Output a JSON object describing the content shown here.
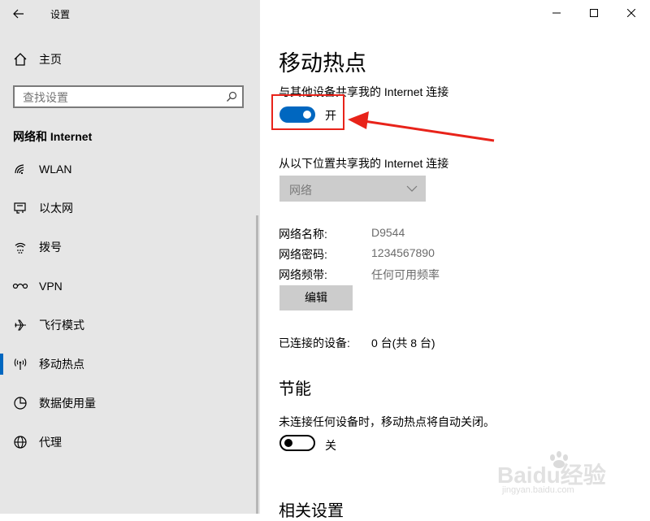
{
  "window": {
    "title": "设置"
  },
  "sidebar": {
    "home_label": "主页",
    "search_placeholder": "查找设置",
    "section_title": "网络和 Internet",
    "items": [
      {
        "label": "WLAN"
      },
      {
        "label": "以太网"
      },
      {
        "label": "拨号"
      },
      {
        "label": "VPN"
      },
      {
        "label": "飞行模式"
      },
      {
        "label": "移动热点"
      },
      {
        "label": "数据使用量"
      },
      {
        "label": "代理"
      }
    ],
    "selected_index": 5
  },
  "main": {
    "page_title": "移动热点",
    "share_label": "与其他设备共享我的 Internet 连接",
    "share_toggle_state": "开",
    "share_from_label": "从以下位置共享我的 Internet 连接",
    "share_from_selected": "网络",
    "props": [
      {
        "key": "网络名称:",
        "value": "D9544"
      },
      {
        "key": "网络密码:",
        "value": "1234567890"
      },
      {
        "key": "网络频带:",
        "value": "任何可用频率"
      }
    ],
    "edit_button": "编辑",
    "connected_label": "已连接的设备:",
    "connected_value": "0 台(共 8 台)",
    "power_title": "节能",
    "power_desc": "未连接任何设备时，移动热点将自动关闭。",
    "power_toggle_state": "关",
    "related_title": "相关设置"
  },
  "watermark": {
    "brand": "Baidu经验",
    "url": "jingyan.baidu.com"
  },
  "colors": {
    "accent": "#0067c0",
    "annotation": "#e8231a",
    "sidebar_bg": "#e6e6e6"
  }
}
